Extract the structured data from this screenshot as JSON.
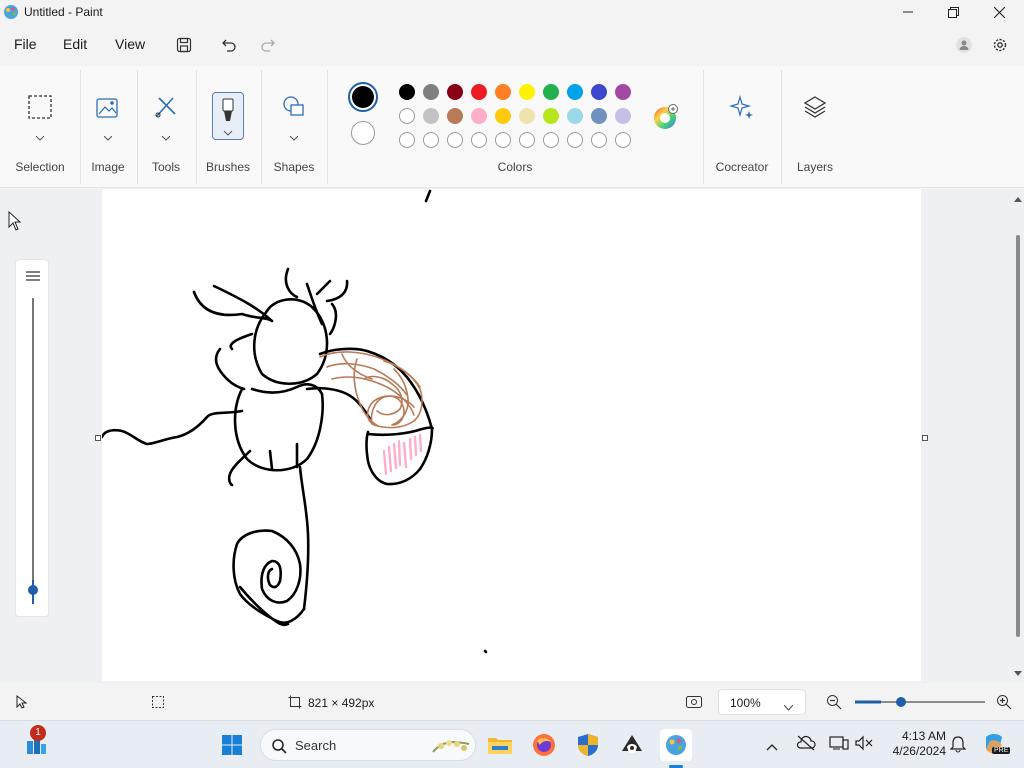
{
  "window": {
    "title": "Untitled - Paint"
  },
  "menu": {
    "file": "File",
    "edit": "Edit",
    "view": "View"
  },
  "ribbon": {
    "selection": "Selection",
    "image": "Image",
    "tools": "Tools",
    "brushes": "Brushes",
    "shapes": "Shapes",
    "colors": "Colors",
    "cocreator": "Cocreator",
    "layers": "Layers"
  },
  "colors": {
    "primary": "#000000",
    "secondary": "#ffffff",
    "row1": [
      "#000000",
      "#7f7f7f",
      "#880015",
      "#ed1c24",
      "#ff7f27",
      "#fff200",
      "#22b14c",
      "#00a2e8",
      "#3f48cc",
      "#a349a4"
    ],
    "row2": [
      "#ffffff",
      "#c3c3c3",
      "#b97a57",
      "#ffaec9",
      "#ffc90e",
      "#efe4b0",
      "#b5e61d",
      "#99d9ea",
      "#7092be",
      "#c8bfe7"
    ]
  },
  "status": {
    "canvas_size": "821 × 492px",
    "zoom": "100%",
    "zoom_level": 0.2
  },
  "taskbar": {
    "search_placeholder": "Search",
    "time": "4:13 AM",
    "date": "4/26/2024",
    "badge": "1",
    "copilot_badge": "PRE"
  }
}
